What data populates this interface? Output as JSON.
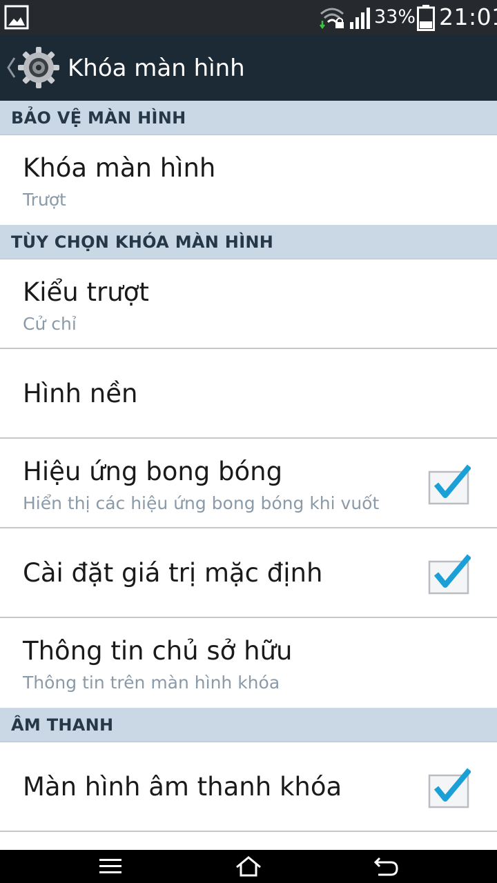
{
  "status_bar": {
    "battery_percent": "33%",
    "time": "21:01",
    "icons": [
      "gallery-icon",
      "wifi-locked-icon",
      "signal-icon",
      "battery-icon"
    ]
  },
  "action_bar": {
    "title": "Khóa màn hình",
    "icon": "settings-gear-icon"
  },
  "sections": [
    {
      "header": "BẢO VỆ MÀN HÌNH",
      "items": [
        {
          "title": "Khóa màn hình",
          "subtitle": "Trượt"
        }
      ]
    },
    {
      "header": "TÙY CHỌN KHÓA MÀN HÌNH",
      "items": [
        {
          "title": "Kiểu trượt",
          "subtitle": "Cử chỉ"
        },
        {
          "title": "Hình nền"
        },
        {
          "title": "Hiệu ứng bong bóng",
          "subtitle": "Hiển thị các hiệu ứng bong bóng khi vuốt",
          "checked": true
        },
        {
          "title": "Cài đặt giá trị mặc định",
          "checked": true
        },
        {
          "title": "Thông tin chủ sở hữu",
          "subtitle": "Thông tin trên màn hình khóa"
        }
      ]
    },
    {
      "header": "ÂM THANH",
      "items": [
        {
          "title": "Màn hình âm thanh khóa",
          "checked": true
        }
      ]
    }
  ],
  "nav_bar": {
    "buttons": [
      "menu-icon",
      "home-icon",
      "back-icon"
    ]
  },
  "colors": {
    "status_bar_bg": "#262a2f",
    "action_bar_bg": "#1c2a36",
    "section_header_bg": "#cad8e6",
    "check_accent": "#1a9fd6"
  }
}
